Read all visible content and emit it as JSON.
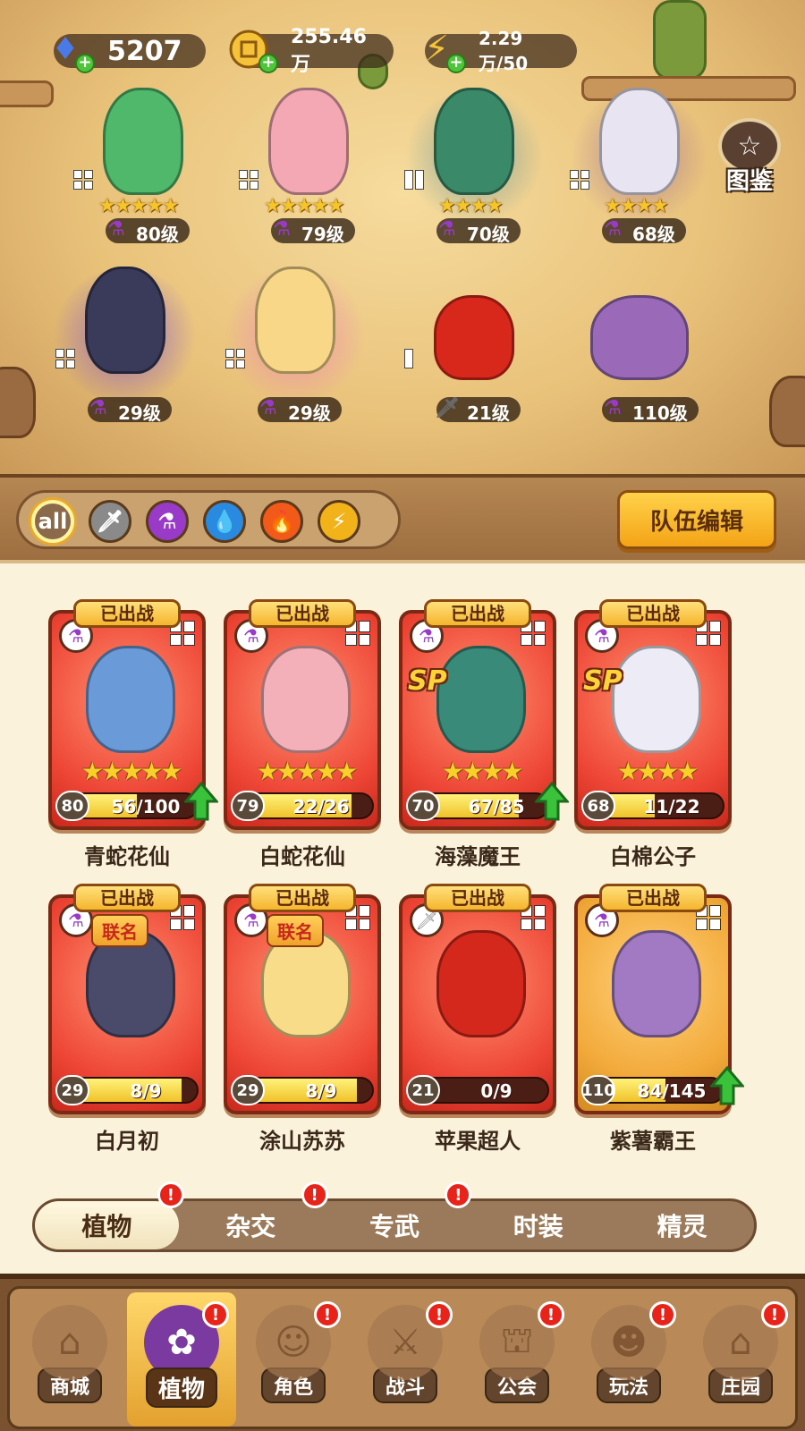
{
  "resources": [
    {
      "name": "gem",
      "icon": "diamond-icon",
      "value": "5207"
    },
    {
      "name": "coin",
      "icon": "coin-icon",
      "value": "255.46万"
    },
    {
      "name": "energy",
      "icon": "lightning-icon",
      "value": "2.29万/50"
    }
  ],
  "atlas_label": "图鉴",
  "lineup": [
    {
      "stars": "★★★★★",
      "level": "80级",
      "type": "potion",
      "color": "#4fb86a"
    },
    {
      "stars": "★★★★★",
      "level": "79级",
      "type": "potion",
      "color": "#f4a8b4"
    },
    {
      "stars": "★★★★",
      "level": "70级",
      "type": "potion",
      "color": "#3a8a6a"
    },
    {
      "stars": "★★★★",
      "level": "68级",
      "type": "potion",
      "color": "#e8e4f2"
    },
    {
      "stars": "",
      "level": "29级",
      "type": "potion",
      "color": "#3a3a5a"
    },
    {
      "stars": "",
      "level": "29级",
      "type": "potion",
      "color": "#f8d888"
    },
    {
      "stars": "",
      "level": "21级",
      "type": "sword",
      "color": "#d8281c"
    },
    {
      "stars": "",
      "level": "110级",
      "type": "potion",
      "color": "#9a6ab8"
    }
  ],
  "filters": {
    "all_label": "all",
    "types": [
      "sword",
      "potion",
      "water",
      "fire",
      "lightning"
    ]
  },
  "team_edit_label": "队伍编辑",
  "deployed_label": "已出战",
  "collab_label": "联名",
  "sp_label": "SP",
  "cards": [
    {
      "name": "青蛇花仙",
      "level": "80",
      "frac": "56/100",
      "progress": 0.56,
      "stars": "★★★★★",
      "upgrade": true,
      "sp": false,
      "collab": false,
      "type": "potion",
      "theme": "red",
      "color": "#6a9ad8"
    },
    {
      "name": "白蛇花仙",
      "level": "79",
      "frac": "22/26",
      "progress": 0.85,
      "stars": "★★★★★",
      "upgrade": false,
      "sp": false,
      "collab": false,
      "type": "potion",
      "theme": "red",
      "color": "#f4b0b8"
    },
    {
      "name": "海藻魔王",
      "level": "70",
      "frac": "67/85",
      "progress": 0.79,
      "stars": "★★★★",
      "upgrade": true,
      "sp": true,
      "collab": false,
      "type": "potion",
      "theme": "red",
      "color": "#3a8a7a"
    },
    {
      "name": "白棉公子",
      "level": "68",
      "frac": "11/22",
      "progress": 0.5,
      "stars": "★★★★",
      "upgrade": false,
      "sp": true,
      "collab": false,
      "type": "potion",
      "theme": "red",
      "color": "#ecebf6"
    },
    {
      "name": "白月初",
      "level": "29",
      "frac": "8/9",
      "progress": 0.89,
      "stars": "",
      "upgrade": false,
      "sp": false,
      "collab": true,
      "type": "potion",
      "theme": "red",
      "color": "#4a4a6a"
    },
    {
      "name": "涂山苏苏",
      "level": "29",
      "frac": "8/9",
      "progress": 0.89,
      "stars": "",
      "upgrade": false,
      "sp": false,
      "collab": true,
      "type": "potion",
      "theme": "red",
      "color": "#f8dc8a"
    },
    {
      "name": "苹果超人",
      "level": "21",
      "frac": "0/9",
      "progress": 0.0,
      "stars": "",
      "upgrade": false,
      "sp": false,
      "collab": false,
      "type": "sword",
      "theme": "red",
      "color": "#d4281c"
    },
    {
      "name": "紫薯霸王",
      "level": "110",
      "frac": "84/145",
      "progress": 0.58,
      "stars": "",
      "upgrade": true,
      "sp": false,
      "collab": false,
      "type": "potion",
      "theme": "gold",
      "color": "#a27ac4"
    }
  ],
  "subtabs": [
    {
      "label": "植物",
      "active": true,
      "alert": true
    },
    {
      "label": "杂交",
      "active": false,
      "alert": true
    },
    {
      "label": "专武",
      "active": false,
      "alert": true
    },
    {
      "label": "时装",
      "active": false,
      "alert": false
    },
    {
      "label": "精灵",
      "active": false,
      "alert": false
    }
  ],
  "alert_mark": "!",
  "nav": [
    {
      "label": "商城",
      "icon": "shop-icon",
      "alert": false,
      "active": false
    },
    {
      "label": "植物",
      "icon": "plant-icon",
      "alert": true,
      "active": true
    },
    {
      "label": "角色",
      "icon": "character-icon",
      "alert": true,
      "active": false
    },
    {
      "label": "战斗",
      "icon": "battle-icon",
      "alert": true,
      "active": false
    },
    {
      "label": "公会",
      "icon": "guild-icon",
      "alert": true,
      "active": false
    },
    {
      "label": "玩法",
      "icon": "gameplay-icon",
      "alert": true,
      "active": false
    },
    {
      "label": "庄园",
      "icon": "manor-icon",
      "alert": true,
      "active": false
    }
  ],
  "colors": {
    "potion": "#9a3ac8",
    "sword": "#8a8a8a",
    "water": "#2a8ae0",
    "fire": "#f25a1a",
    "lightning": "#f2b21a",
    "upgrade": "#3ac23a"
  }
}
